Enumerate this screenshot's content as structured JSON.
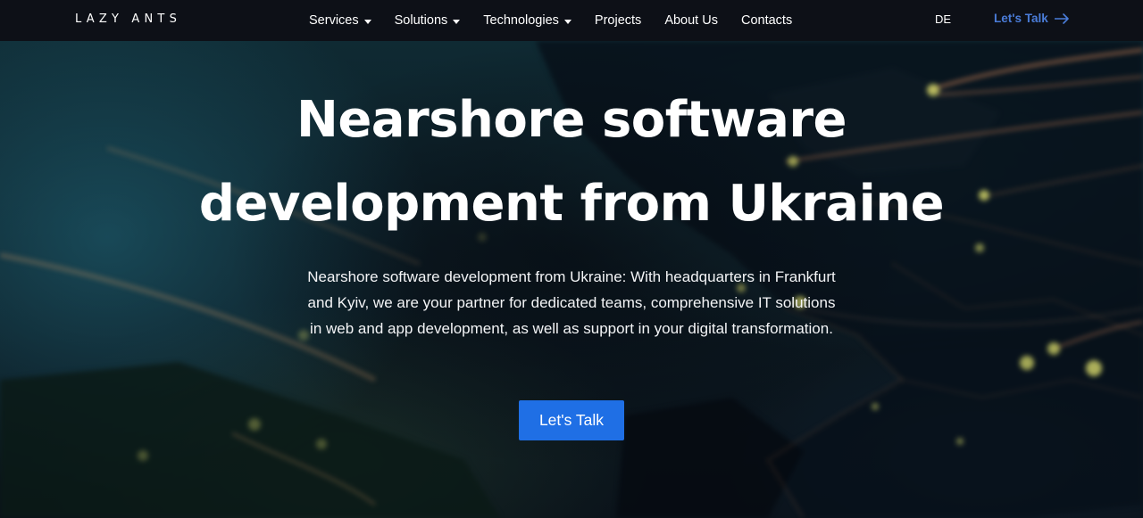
{
  "header": {
    "logo": "LAZY ANTS",
    "nav": [
      {
        "label": "Services",
        "dropdown": true
      },
      {
        "label": "Solutions",
        "dropdown": true
      },
      {
        "label": "Technologies",
        "dropdown": true
      },
      {
        "label": "Projects",
        "dropdown": false
      },
      {
        "label": "About Us",
        "dropdown": false
      },
      {
        "label": "Contacts",
        "dropdown": false
      }
    ],
    "language": "DE",
    "cta_label": "Let's Talk"
  },
  "hero": {
    "headline_line1": "Nearshore software",
    "headline_line2": "development from Ukraine",
    "description": "Nearshore software development from Ukraine: With headquarters in Frankfurt and Kyiv, we are your partner for dedicated teams, comprehensive IT solutions in web and app development, as well as support in your digital transformation.",
    "cta_label": "Let's Talk"
  },
  "colors": {
    "header_bg": "#0d1017",
    "accent_link": "#4a7cd8",
    "button_bg": "#1f6fe5"
  }
}
